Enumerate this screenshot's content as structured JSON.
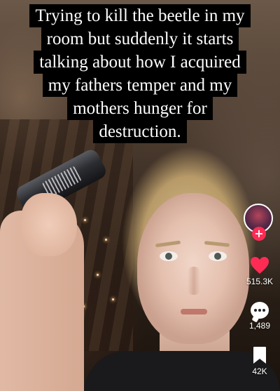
{
  "caption": {
    "lines": [
      "Trying to kill the beetle in my",
      "room but suddenly it starts",
      "talking about how I acquired",
      "my fathers temper and my",
      "mothers hunger for",
      "destruction."
    ]
  },
  "side_actions": {
    "follow_symbol": "+",
    "likes": "515.3K",
    "comments": "1,489",
    "saves": "42K"
  },
  "icons": {
    "like": "heart-icon",
    "comment": "comment-bubble-icon",
    "save": "bookmark-icon",
    "follow": "plus-icon"
  },
  "colors": {
    "like_heart": "#fe2c55",
    "follow_badge": "#fe2c55",
    "caption_background": "#000000",
    "caption_text": "#ffffff"
  }
}
